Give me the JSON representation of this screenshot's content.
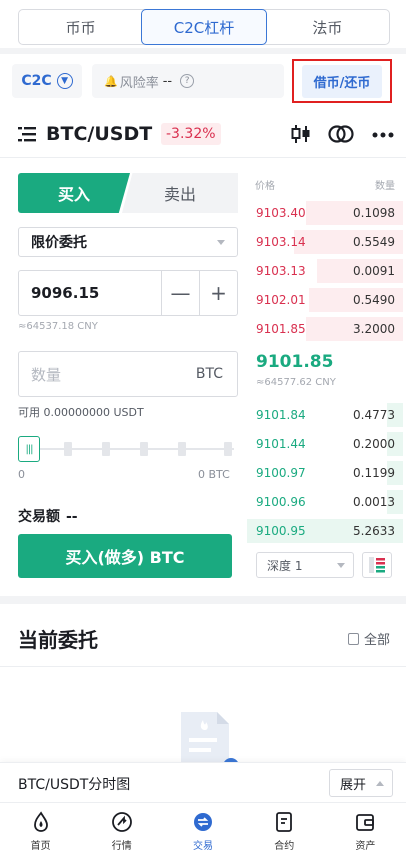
{
  "top_tabs": [
    "币币",
    "C2C杠杆",
    "法币"
  ],
  "mode": {
    "label": "C2C"
  },
  "risk": {
    "label": "风险率",
    "value": "--"
  },
  "borrow_button": "借币/还币",
  "pair": {
    "symbol": "BTC/USDT",
    "change": "-3.32%"
  },
  "side_tabs": {
    "buy": "买入",
    "sell": "卖出"
  },
  "order_type": "限价委托",
  "price": {
    "value": "9096.15",
    "cny": "≈64537.18 CNY"
  },
  "amount": {
    "placeholder": "数量",
    "unit": "BTC"
  },
  "available": "可用 0.00000000 USDT",
  "slider": {
    "min_label": "0",
    "max_label": "0 BTC",
    "level": 0
  },
  "trade_amount": {
    "label": "交易额",
    "value": "--"
  },
  "buy_button": "买入(做多) BTC",
  "order_book": {
    "headers": {
      "price": "价格",
      "qty": "数量"
    },
    "asks": [
      {
        "price": "9103.40",
        "qty": "0.1098",
        "depth": 0.62
      },
      {
        "price": "9103.14",
        "qty": "0.5549",
        "depth": 0.7
      },
      {
        "price": "9103.13",
        "qty": "0.0091",
        "depth": 0.55
      },
      {
        "price": "9102.01",
        "qty": "0.5490",
        "depth": 0.6
      },
      {
        "price": "9101.85",
        "qty": "3.2000",
        "depth": 0.62
      }
    ],
    "last_price": "9101.85",
    "last_cny": "≈64577.62 CNY",
    "bids": [
      {
        "price": "9101.84",
        "qty": "0.4773",
        "depth": 0.1
      },
      {
        "price": "9101.44",
        "qty": "0.2000",
        "depth": 0.1
      },
      {
        "price": "9100.97",
        "qty": "0.1199",
        "depth": 0.1
      },
      {
        "price": "9100.96",
        "qty": "0.0013",
        "depth": 0.1
      },
      {
        "price": "9100.95",
        "qty": "5.2633",
        "depth": 1.0
      }
    ]
  },
  "depth_select": "深度 1",
  "orders": {
    "title": "当前委托",
    "all": "全部"
  },
  "chart_bar": {
    "title": "BTC/USDT分时图",
    "expand": "展开"
  },
  "bottom_nav": [
    {
      "label": "首页",
      "icon": "home-icon"
    },
    {
      "label": "行情",
      "icon": "market-icon"
    },
    {
      "label": "交易",
      "icon": "trade-icon",
      "active": true
    },
    {
      "label": "合约",
      "icon": "contract-icon"
    },
    {
      "label": "资产",
      "icon": "assets-icon"
    }
  ],
  "colors": {
    "buy": "#1aaa80",
    "sell": "#d9304f",
    "accent": "#2f6ad0",
    "highlight_border": "#e02020"
  }
}
